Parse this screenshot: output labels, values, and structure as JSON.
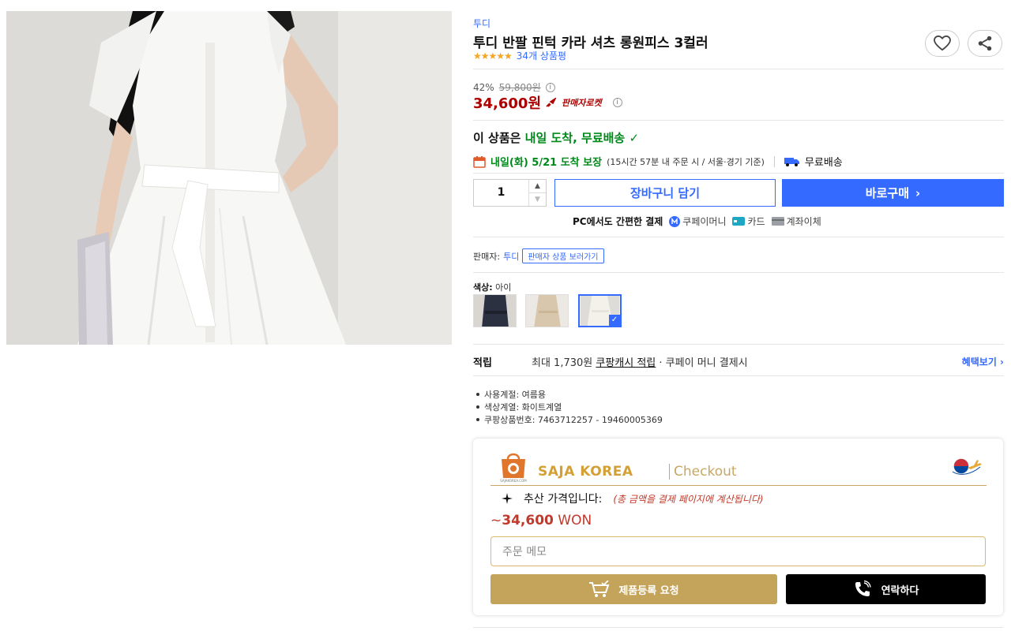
{
  "product": {
    "brand": "투디",
    "title": "투디 반팔 핀턱 카라 셔츠 롱원피스 3컬러",
    "stars": "★★★★★",
    "review_count": "34개 상품평",
    "rating_fraction": 0.9
  },
  "icons": {
    "heart": "heart-icon",
    "share": "share-icon",
    "info": "info-icon",
    "calendar": "calendar-icon",
    "truck": "truck-icon",
    "coupay": "coupay-icon",
    "card": "card-icon",
    "bank": "bank-icon",
    "cart": "cart-icon",
    "phone": "phone-icon",
    "sparkle": "sparkle-icon",
    "info_glyph": "i"
  },
  "price": {
    "discount_rate": "42%",
    "original": "59,800원",
    "sale": "34,600원",
    "rocket_label": "판매자로켓"
  },
  "delivery": {
    "headline_prefix": "이 상품은",
    "headline_highlight": "내일 도착, 무료배송",
    "check": "✓",
    "guarantee": "내일(화) 5/21 도착 보장",
    "time_left": "(15시간 57분  내 주문 시 / 서울·경기 기준)",
    "free_shipping": "무료배송"
  },
  "purchase": {
    "quantity": "1",
    "qty_up": "▲",
    "qty_down": "▼",
    "cart_label": "장바구니 담기",
    "buy_label": "바로구매",
    "buy_chevron": "›"
  },
  "payment": {
    "lead": "PC에서도 간편한 결제",
    "coupay": "쿠페이머니",
    "card": "카드",
    "bank": "계좌이체"
  },
  "seller": {
    "label": "판매자:",
    "name": "투디",
    "tag": "판매자 상품 보러가기"
  },
  "color": {
    "label": "색상:",
    "value": "아이",
    "options": [
      {
        "name": "네이비",
        "hex": "#2b3140"
      },
      {
        "name": "베이지",
        "hex": "#d9c7ad"
      },
      {
        "name": "아이",
        "hex": "#f4f1ea"
      }
    ],
    "selected_index": 2
  },
  "reward": {
    "label": "적립",
    "text_prefix": "최대 1,730원",
    "text_link": "쿠팡캐시 적립",
    "text_suffix": "· 쿠페이 머니 결제시",
    "benefit": "혜택보기 ›"
  },
  "specs": [
    "사용계절: 여름용",
    "색상계열: 화이트계열",
    "쿠팡상품번호: 7463712257 - 19460005369"
  ],
  "saja": {
    "name": "SAJA KOREA",
    "checkout": "Checkout",
    "estimate_label": "추산 가격입니다:",
    "estimate_note": "(총 금액을 결제 페이지에 계산됩니다)",
    "won_prefix": "~",
    "won_amount": "34,600",
    "won_unit": "WON",
    "memo_placeholder": "주문 메모",
    "request_label": "제품등록 요청",
    "contact_label": "연락하다",
    "logo_text": "SAJAKOREA.COM"
  },
  "colors": {
    "accent_blue": "#346aff",
    "price_red": "#ae0000",
    "green": "#00891a",
    "saja_gold": "#c4a35a",
    "saja_orange": "#d4a035"
  }
}
